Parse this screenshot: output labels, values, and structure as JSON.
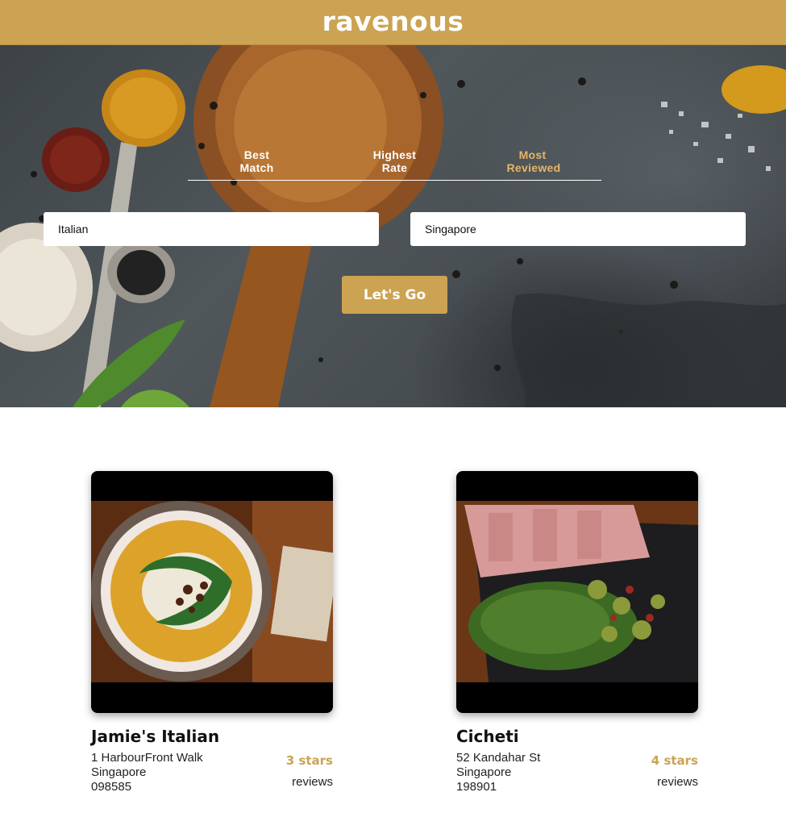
{
  "header": {
    "brand": "ravenous"
  },
  "search": {
    "sort_options": [
      {
        "label": "Best Match",
        "active": false
      },
      {
        "label": "Highest Rate",
        "active": false
      },
      {
        "label": "Most Reviewed",
        "active": true
      }
    ],
    "term_value": "Italian",
    "location_value": "Singapore",
    "submit_label": "Let's Go"
  },
  "businesses": [
    {
      "name": "Jamie's Italian",
      "address": "1 HarbourFront Walk",
      "city": "Singapore",
      "zip": "098585",
      "rating": "3 stars",
      "reviews": "reviews"
    },
    {
      "name": "Cicheti",
      "address": "52 Kandahar St",
      "city": "Singapore",
      "zip": "198901",
      "rating": "4 stars",
      "reviews": "reviews"
    }
  ],
  "colors": {
    "brand": "#cca353",
    "active_sort": "#e7b567"
  }
}
